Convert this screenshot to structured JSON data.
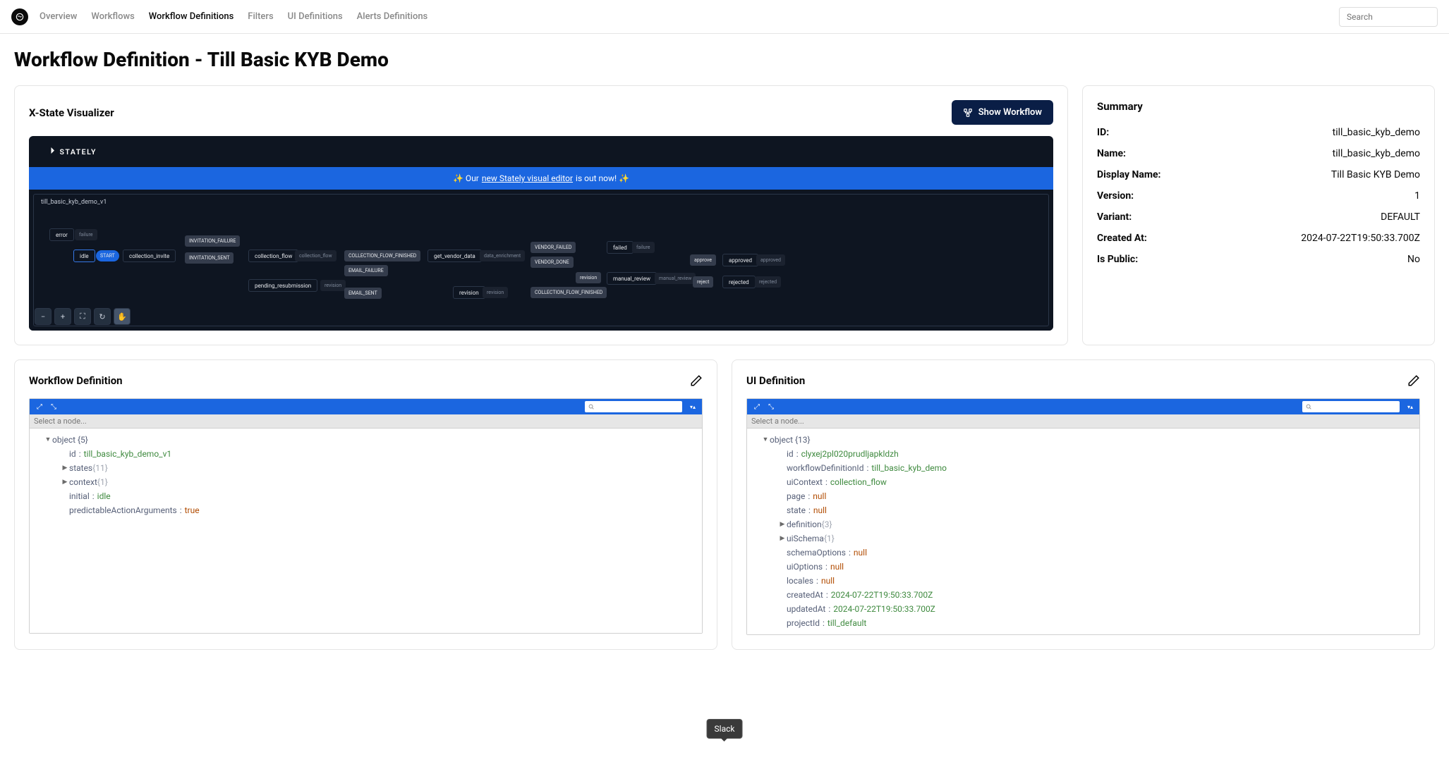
{
  "nav": {
    "items": [
      "Overview",
      "Workflows",
      "Workflow Definitions",
      "Filters",
      "UI Definitions",
      "Alerts Definitions"
    ],
    "active_index": 2,
    "search_placeholder": "Search"
  },
  "page_title": "Workflow Definition - Till Basic KYB Demo",
  "visualizer": {
    "title": "X-State Visualizer",
    "button": "Show Workflow",
    "stately_brand": "STATELY",
    "banner_pre": "✨ Our ",
    "banner_link": "new Stately visual editor",
    "banner_post": " is out now! ✨",
    "machine_title": "till_basic_kyb_demo_v1",
    "states": {
      "error": "error",
      "idle": "idle",
      "collection_invite": "collection_invite",
      "collection_flow": "collection_flow",
      "pending_resubmission": "pending_resubmission",
      "get_vendor_data": "get_vendor_data",
      "revision": "revision",
      "manual_review": "manual_review",
      "failed": "failed",
      "approved": "approved",
      "rejected": "rejected"
    },
    "events": {
      "failure": "failure",
      "start": "START",
      "invitation_failure": "INVITATION_FAILURE",
      "invitation_sent": "INVITATION_SENT",
      "collection_flow_finished": "COLLECTION_FLOW_FINISHED",
      "collection_flow_finished2": "COLLECTION_FLOW_FINISHED",
      "email_failure": "EMAIL_FAILURE",
      "email_sent": "EMAIL_SENT",
      "vendor_failed": "VENDOR_FAILED",
      "vendor_done": "VENDOR_DONE",
      "revision": "revision",
      "approve": "approve",
      "reject": "reject"
    },
    "badges": {
      "collection_flow": "collection_flow",
      "revision": "revision",
      "revision2": "revision",
      "data_enrichment": "data_enrichment",
      "manual_review": "manual_review",
      "approved": "approved",
      "rejected": "rejected",
      "failure": "failure"
    }
  },
  "summary": {
    "title": "Summary",
    "rows": [
      {
        "k": "ID:",
        "v": "till_basic_kyb_demo"
      },
      {
        "k": "Name:",
        "v": "till_basic_kyb_demo"
      },
      {
        "k": "Display Name:",
        "v": "Till Basic KYB Demo"
      },
      {
        "k": "Version:",
        "v": "1"
      },
      {
        "k": "Variant:",
        "v": "DEFAULT"
      },
      {
        "k": "Created At:",
        "v": "2024-07-22T19:50:33.700Z"
      },
      {
        "k": "Is Public:",
        "v": "No"
      }
    ]
  },
  "wf_def": {
    "title": "Workflow Definition",
    "select_placeholder": "Select a node...",
    "root": "object {5}",
    "rows": [
      {
        "k": "id",
        "sep": ":",
        "v": "till_basic_kyb_demo_v1",
        "t": "str"
      },
      {
        "k": "states",
        "nest": "{11}",
        "expandable": true
      },
      {
        "k": "context",
        "nest": "{1}",
        "expandable": true
      },
      {
        "k": "initial",
        "sep": ":",
        "v": "idle",
        "t": "str"
      },
      {
        "k": "predictableActionArguments",
        "sep": ":",
        "v": "true",
        "t": "bool"
      }
    ]
  },
  "ui_def": {
    "title": "UI Definition",
    "select_placeholder": "Select a node...",
    "root": "object {13}",
    "rows": [
      {
        "k": "id",
        "sep": ":",
        "v": "clyxej2pl020prudljapkldzh",
        "t": "str"
      },
      {
        "k": "workflowDefinitionId",
        "sep": ":",
        "v": "till_basic_kyb_demo",
        "t": "str"
      },
      {
        "k": "uiContext",
        "sep": ":",
        "v": "collection_flow",
        "t": "str"
      },
      {
        "k": "page",
        "sep": ":",
        "v": "null",
        "t": "null"
      },
      {
        "k": "state",
        "sep": ":",
        "v": "null",
        "t": "null"
      },
      {
        "k": "definition",
        "nest": "{3}",
        "expandable": true
      },
      {
        "k": "uiSchema",
        "nest": "{1}",
        "expandable": true
      },
      {
        "k": "schemaOptions",
        "sep": ":",
        "v": "null",
        "t": "null"
      },
      {
        "k": "uiOptions",
        "sep": ":",
        "v": "null",
        "t": "null"
      },
      {
        "k": "locales",
        "sep": ":",
        "v": "null",
        "t": "null"
      },
      {
        "k": "createdAt",
        "sep": ":",
        "v": "2024-07-22T19:50:33.700Z",
        "t": "str"
      },
      {
        "k": "updatedAt",
        "sep": ":",
        "v": "2024-07-22T19:50:33.700Z",
        "t": "str"
      },
      {
        "k": "projectId",
        "sep": ":",
        "v": "till_default",
        "t": "str"
      }
    ]
  },
  "tooltip": "Slack"
}
